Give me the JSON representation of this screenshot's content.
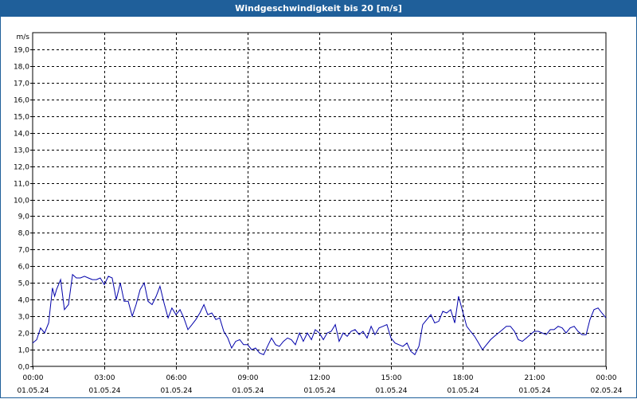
{
  "window": {
    "title": "Windgeschwindigkeit bis 20 [m/s]"
  },
  "chart_data": {
    "type": "line",
    "title": "Windgeschwindigkeit bis 20 [m/s]",
    "ylabel": "m/s",
    "xlabel": "",
    "ylim": [
      0,
      20
    ],
    "xlim_hours": [
      0,
      24
    ],
    "grid": true,
    "y_ticks": [
      "0,0",
      "1,0",
      "2,0",
      "3,0",
      "4,0",
      "5,0",
      "6,0",
      "7,0",
      "8,0",
      "9,0",
      "10,0",
      "11,0",
      "12,0",
      "13,0",
      "14,0",
      "15,0",
      "16,0",
      "17,0",
      "18,0",
      "19,0"
    ],
    "x_ticks": [
      {
        "time": "00:00",
        "date": "01.05.24"
      },
      {
        "time": "03:00",
        "date": "01.05.24"
      },
      {
        "time": "06:00",
        "date": "01.05.24"
      },
      {
        "time": "09:00",
        "date": "01.05.24"
      },
      {
        "time": "12:00",
        "date": "01.05.24"
      },
      {
        "time": "15:00",
        "date": "01.05.24"
      },
      {
        "time": "18:00",
        "date": "01.05.24"
      },
      {
        "time": "21:00",
        "date": "01.05.24"
      },
      {
        "time": "00:00",
        "date": "02.05.24"
      }
    ],
    "series": [
      {
        "color": "#0000aa",
        "x": [
          0.0,
          0.17,
          0.33,
          0.5,
          0.67,
          0.83,
          0.92,
          1.0,
          1.17,
          1.33,
          1.5,
          1.67,
          1.83,
          2.0,
          2.17,
          2.33,
          2.5,
          2.67,
          2.83,
          3.0,
          3.17,
          3.33,
          3.5,
          3.67,
          3.83,
          4.0,
          4.17,
          4.33,
          4.5,
          4.67,
          4.83,
          5.0,
          5.17,
          5.33,
          5.5,
          5.67,
          5.83,
          6.0,
          6.17,
          6.33,
          6.5,
          6.67,
          6.83,
          7.0,
          7.17,
          7.33,
          7.5,
          7.67,
          7.83,
          8.0,
          8.17,
          8.33,
          8.5,
          8.67,
          8.83,
          9.0,
          9.17,
          9.33,
          9.5,
          9.67,
          9.83,
          10.0,
          10.17,
          10.33,
          10.5,
          10.67,
          10.83,
          11.0,
          11.17,
          11.33,
          11.5,
          11.67,
          11.83,
          12.0,
          12.17,
          12.33,
          12.5,
          12.67,
          12.83,
          13.0,
          13.17,
          13.33,
          13.5,
          13.67,
          13.83,
          14.0,
          14.17,
          14.33,
          14.5,
          14.67,
          14.83,
          15.0,
          15.17,
          15.33,
          15.5,
          15.67,
          15.83,
          16.0,
          16.17,
          16.33,
          16.5,
          16.67,
          16.83,
          17.0,
          17.17,
          17.33,
          17.5,
          17.67,
          17.83,
          18.0,
          18.17,
          18.33,
          18.5,
          18.67,
          18.83,
          19.0,
          19.17,
          19.33,
          19.5,
          19.67,
          19.83,
          20.0,
          20.17,
          20.33,
          20.5,
          20.67,
          20.83,
          21.0,
          21.17,
          21.33,
          21.5,
          21.67,
          21.83,
          22.0,
          22.17,
          22.33,
          22.5,
          22.67,
          22.83,
          23.0,
          23.17,
          23.33,
          23.5,
          23.67,
          23.83,
          24.0
        ],
        "values": [
          1.4,
          1.6,
          2.3,
          2.0,
          2.6,
          4.7,
          4.2,
          4.6,
          5.2,
          3.4,
          3.7,
          5.5,
          5.3,
          5.3,
          5.4,
          5.3,
          5.2,
          5.2,
          5.3,
          4.9,
          5.4,
          5.3,
          4.0,
          5.0,
          3.9,
          3.9,
          3.0,
          3.7,
          4.6,
          5.0,
          3.9,
          3.7,
          4.2,
          4.8,
          3.8,
          2.9,
          3.5,
          3.1,
          3.4,
          2.9,
          2.2,
          2.5,
          2.8,
          3.2,
          3.7,
          3.1,
          3.2,
          2.8,
          2.9,
          2.1,
          1.7,
          1.1,
          1.5,
          1.6,
          1.3,
          1.3,
          1.0,
          1.1,
          0.8,
          0.7,
          1.2,
          1.7,
          1.3,
          1.2,
          1.5,
          1.7,
          1.6,
          1.3,
          2.0,
          1.5,
          2.0,
          1.6,
          2.2,
          2.0,
          1.6,
          2.0,
          2.1,
          2.5,
          1.5,
          2.0,
          1.8,
          2.1,
          2.2,
          1.9,
          2.1,
          1.7,
          2.4,
          1.9,
          2.3,
          2.4,
          2.5,
          1.7,
          1.4,
          1.3,
          1.2,
          1.4,
          0.9,
          0.7,
          1.2,
          2.5,
          2.8,
          3.1,
          2.6,
          2.7,
          3.3,
          3.2,
          3.4,
          2.6,
          4.2,
          3.3,
          2.4,
          2.1,
          1.8,
          1.4,
          1.0,
          1.3,
          1.6,
          1.8,
          2.0,
          2.2,
          2.4,
          2.4,
          2.1,
          1.6,
          1.5,
          1.7,
          1.9,
          2.1,
          2.1,
          2.0,
          1.9,
          2.2,
          2.2,
          2.4,
          2.3,
          2.0,
          2.3,
          2.4,
          2.1,
          1.9,
          1.9,
          2.8,
          3.4,
          3.5,
          3.2,
          2.9
        ]
      }
    ]
  }
}
